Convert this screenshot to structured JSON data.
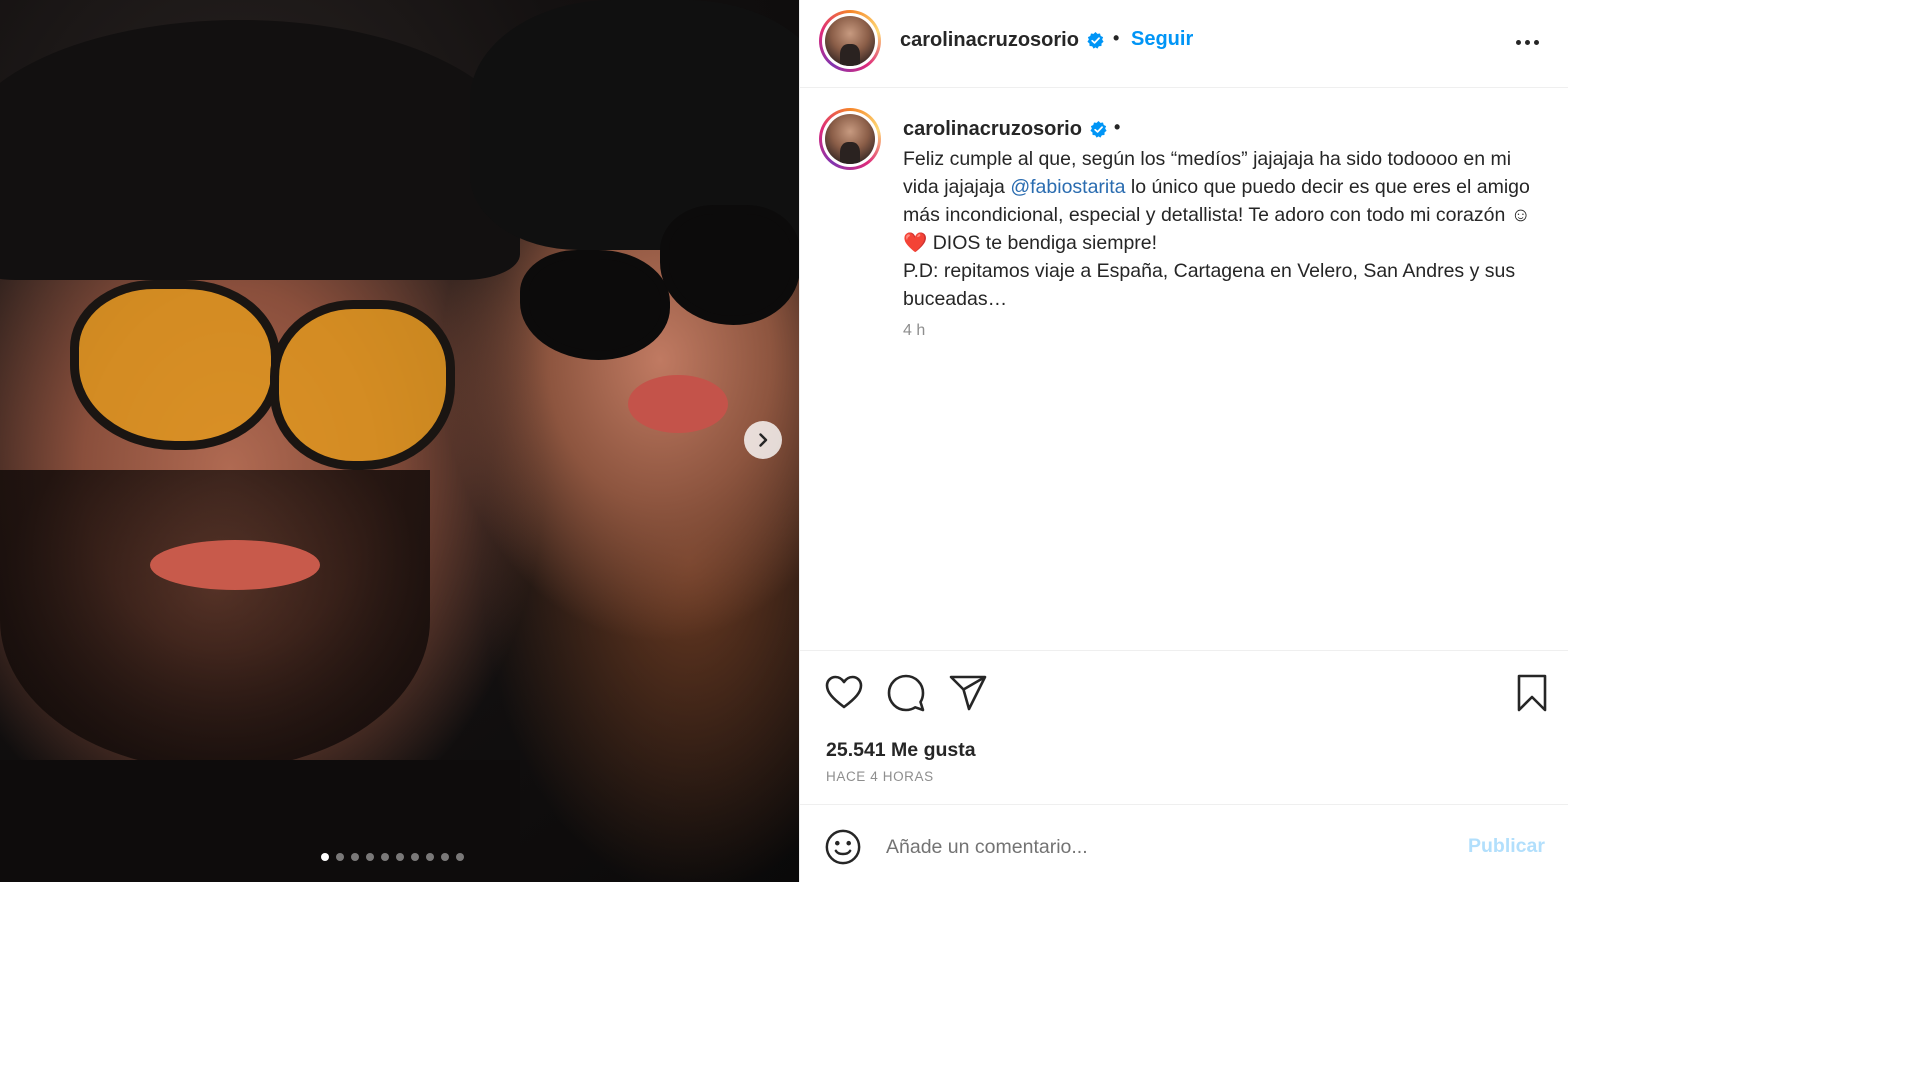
{
  "post": {
    "username": "carolinacruzosorio",
    "verified": true,
    "follow_label": "Seguir",
    "separator": "•"
  },
  "media": {
    "slide_count": 10,
    "active_slide": 1,
    "next_icon": "chevron-right-icon"
  },
  "caption": {
    "username": "carolinacruzosorio",
    "separator": "•",
    "line1": "Feliz cumple al que, según los “medíos” jajajaja ha sido todoooo en mi vida jajajaja ",
    "mention": "@fabiostarita",
    "line2": " lo único que puedo decir es que eres el amigo más incondicional, especial y detallista! Te adoro con todo mi corazón ☺",
    "heart": "❤️",
    "line3": " DIOS te bendiga siempre!",
    "line4": "P.D: repitamos viaje a España, Cartagena en Velero, San Andres y sus buceadas…",
    "time": "4 h"
  },
  "actions": {
    "like_icon": "heart-icon",
    "comment_icon": "comment-icon",
    "share_icon": "send-icon",
    "save_icon": "bookmark-icon",
    "likes": "25.541 Me gusta",
    "date": "HACE 4 HORAS"
  },
  "comment": {
    "emoji_icon": "smiley-icon",
    "placeholder": "Añade un comentario...",
    "publish_label": "Publicar"
  },
  "colors": {
    "link": "#0095f6",
    "verified": "#0095f6",
    "publish_disabled": "#b2dffc",
    "muted": "#8e8e8e"
  }
}
